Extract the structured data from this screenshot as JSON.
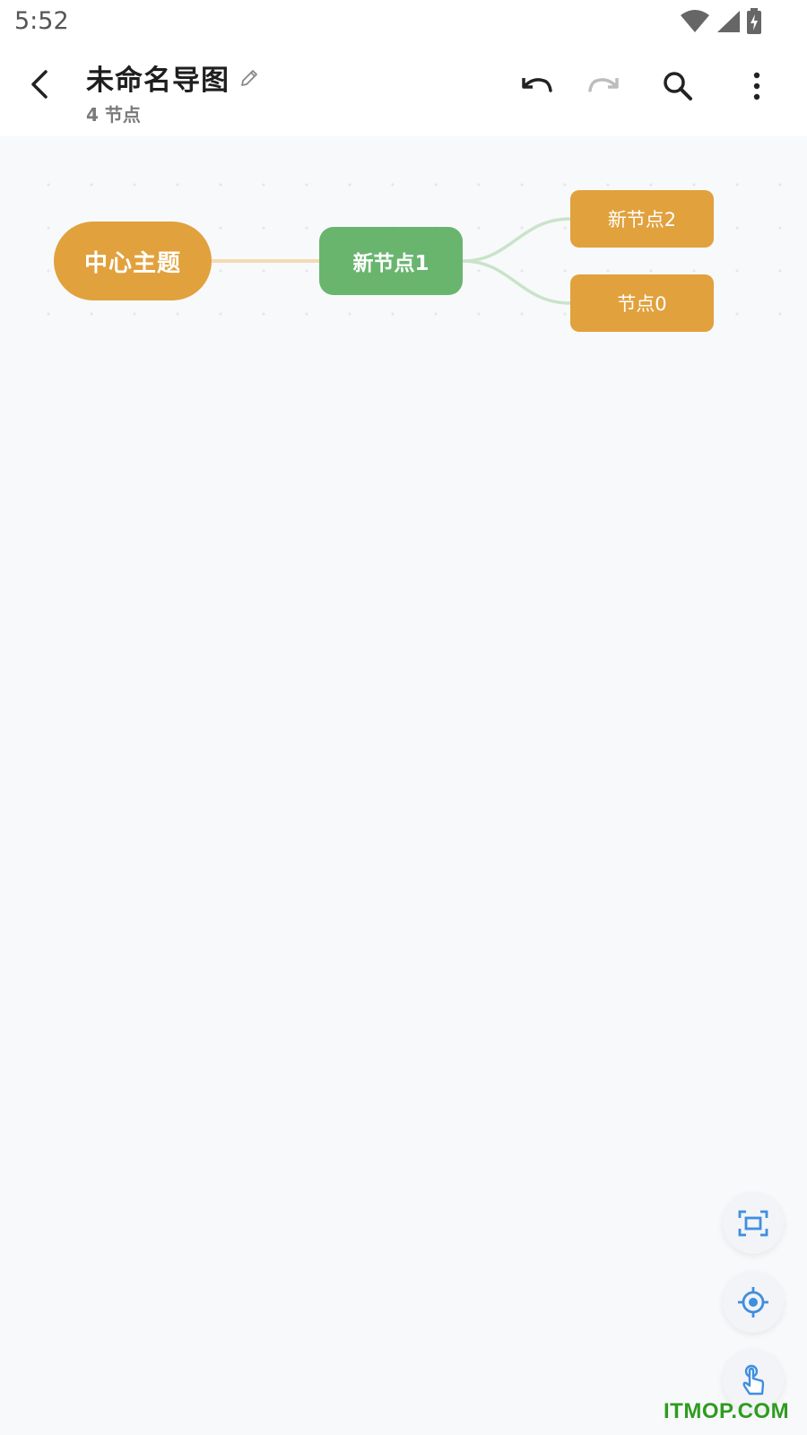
{
  "status_bar": {
    "time": "5:52",
    "icons": [
      "wifi-icon",
      "signal-icon",
      "battery-charging-icon"
    ]
  },
  "app_bar": {
    "title": "未命名导图",
    "subtitle": "4 节点",
    "icons": {
      "back": "arrow-left-icon",
      "edit": "pencil-icon",
      "undo": "undo-icon",
      "redo": "redo-icon",
      "search": "search-icon",
      "more": "more-vert-icon"
    }
  },
  "mindmap": {
    "root": "中心主题",
    "child": "新节点1",
    "leaves": [
      "新节点2",
      "节点0"
    ],
    "colors": {
      "orange": "#e1a13d",
      "green": "#69b56e",
      "link_orange": "#f3dbb4",
      "link_green": "#c9e3ca"
    }
  },
  "fabs": {
    "icons": [
      "fit-screen-icon",
      "center-target-icon",
      "touch-icon"
    ],
    "color": "#3f8ee0"
  },
  "watermark": "ITMOP.COM"
}
